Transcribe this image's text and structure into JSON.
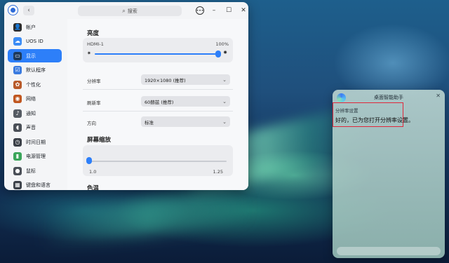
{
  "window": {
    "search_placeholder": "搜索",
    "menu_icon": "more-icon",
    "min_icon": "minimize-icon",
    "max_icon": "maximize-icon",
    "close_icon": "close-icon"
  },
  "sidebar": {
    "items": [
      {
        "label": "帐户",
        "icon": "account-icon",
        "color": "#2b2b2b"
      },
      {
        "label": "UOS ID",
        "icon": "cloud-icon",
        "color": "#3b8cf5"
      },
      {
        "label": "显示",
        "icon": "display-icon",
        "color": "#1d3a5c",
        "active": true
      },
      {
        "label": "默认程序",
        "icon": "default-apps-icon",
        "color": "#3a7be0"
      },
      {
        "label": "个性化",
        "icon": "personalization-icon",
        "color": "#b85a2a"
      },
      {
        "label": "网络",
        "icon": "network-icon",
        "color": "#c0561f"
      },
      {
        "label": "通知",
        "icon": "notification-icon",
        "color": "#555b63"
      },
      {
        "label": "声音",
        "icon": "sound-icon",
        "color": "#4a4f57"
      },
      {
        "label": "时间日期",
        "icon": "clock-icon",
        "color": "#3a3f47"
      },
      {
        "label": "电源管理",
        "icon": "power-icon",
        "color": "#3aa55a"
      },
      {
        "label": "鼠标",
        "icon": "mouse-icon",
        "color": "#4a4f57"
      },
      {
        "label": "键盘和语言",
        "icon": "keyboard-icon",
        "color": "#3a3f47"
      }
    ]
  },
  "display": {
    "brightness_title": "亮度",
    "monitor_name": "HDMI-1",
    "brightness_value": "100%",
    "brightness_level": 1.0,
    "resolution_label": "分辨率",
    "resolution_value": "1920×1080 (推荐)",
    "refresh_label": "刷新率",
    "refresh_value": "60赫兹 (推荐)",
    "orientation_label": "方向",
    "orientation_value": "标准",
    "scaling_title": "屏幕缩放",
    "scaling_min": "1.0",
    "scaling_max": "1.25",
    "scaling_level": 0.0,
    "color_temp_title": "色温"
  },
  "assistant": {
    "title": "桌面智能助手",
    "request": "分辨率设置",
    "reply": "好的，已为您打开分辨率设置。",
    "highlight_color": "#e0283a"
  }
}
